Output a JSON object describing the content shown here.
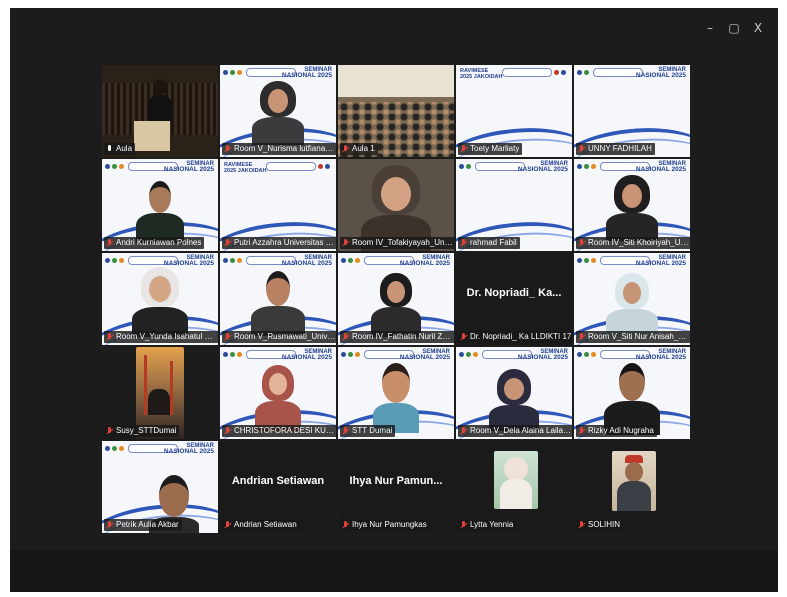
{
  "window": {
    "controls": {
      "minimize": "–",
      "restore": "▢",
      "close": "X"
    }
  },
  "banner": {
    "title_line1": "SEMINAR",
    "title_line2": "NASIONAL 2025",
    "ravimese_line1": "RAVIMESE",
    "ravimese_line2": "2025 JAKOIDAH"
  },
  "participants": [
    {
      "name": "Aula",
      "mic": "on"
    },
    {
      "name": "Room V_Nurisma lutfiana_Univ...",
      "mic": "off"
    },
    {
      "name": "Aula 1",
      "mic": "off"
    },
    {
      "name": "Toety Marliaty",
      "mic": "off"
    },
    {
      "name": "UNNY FADHILAH",
      "mic": "off"
    },
    {
      "name": "Andri Kurniawan Polnes",
      "mic": "off"
    },
    {
      "name": "Putri Azzahra Universitas Mu...",
      "mic": "off"
    },
    {
      "name": "Room IV_Tofakiyayah_Universit...",
      "mic": "off"
    },
    {
      "name": "rahmad Fabil",
      "mic": "off"
    },
    {
      "name": "Room IV_Siti Khoiriyah_Univer...",
      "mic": "off"
    },
    {
      "name": "Room V_Yunda Isahatul Mua...",
      "mic": "off"
    },
    {
      "name": "Room V_Rusmawati_Universit...",
      "mic": "off"
    },
    {
      "name": "Room IV_Fathatin Nuril Zama...",
      "mic": "off"
    },
    {
      "name": "Dr. Nopriadi_ Ka LLDIKTI 17",
      "mic": "off",
      "display": "Dr. Nopriadi_ Ka..."
    },
    {
      "name": "Room V_Siti Nur Anisah_Unive...",
      "mic": "off"
    },
    {
      "name": "Susy_STTDumai",
      "mic": "off"
    },
    {
      "name": "CHRISTOFORA DESI KUSMIN...",
      "mic": "off"
    },
    {
      "name": "STT Dumai",
      "mic": "off"
    },
    {
      "name": "Room V_Dela Alaina Lailatul ...",
      "mic": "off"
    },
    {
      "name": "Rizky Adi Nugraha",
      "mic": "off"
    },
    {
      "name": "Petrik Aulia Akbar",
      "mic": "off"
    },
    {
      "name": "Andrian Setiawan",
      "mic": "off",
      "display": "Andrian Setiawan"
    },
    {
      "name": "Ihya Nur Pamungkas",
      "mic": "off",
      "display": "Ihya Nur Pamun..."
    },
    {
      "name": "Lytta Yennia",
      "mic": "off"
    },
    {
      "name": "SOLIHIN",
      "mic": "off"
    }
  ]
}
